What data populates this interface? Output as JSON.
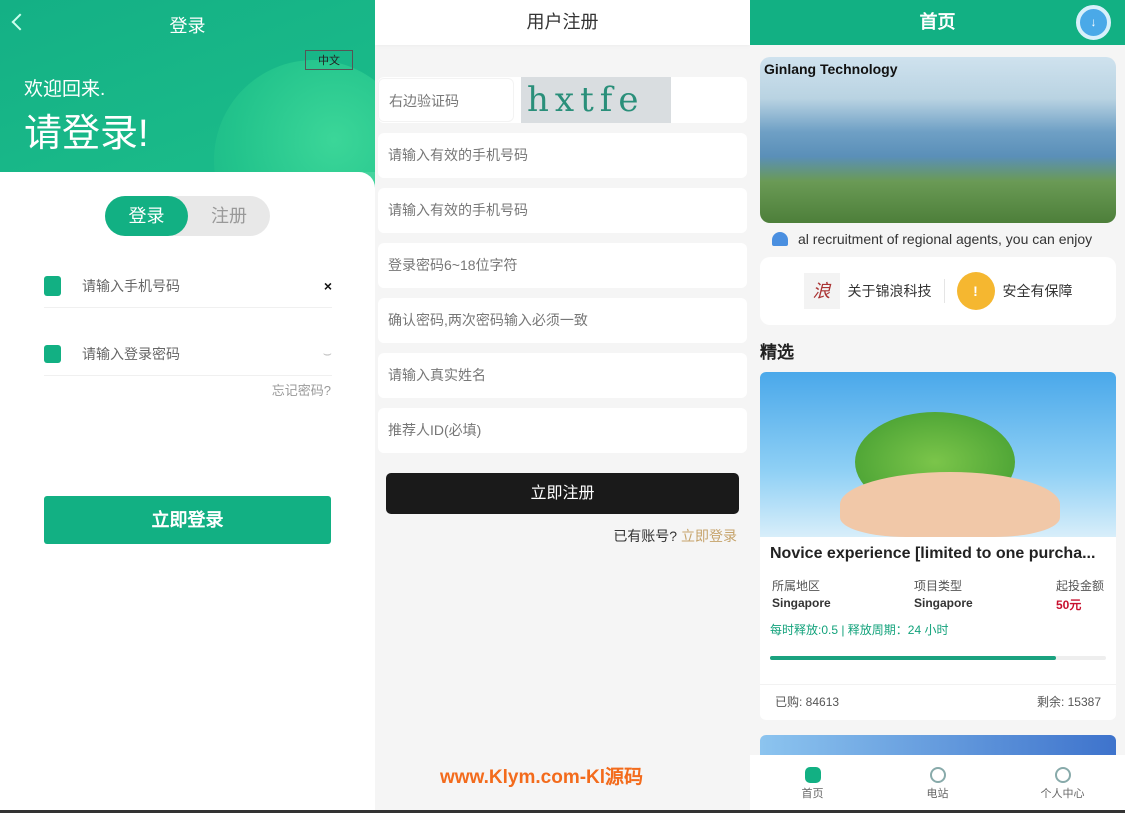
{
  "login": {
    "title": "登录",
    "lang": "中文",
    "welcome": "欢迎回来.",
    "please": "请登录!",
    "tab_login": "登录",
    "tab_register": "注册",
    "phone_placeholder": "请输入手机号码",
    "clear": "×",
    "password_placeholder": "请输入登录密码",
    "forgot": "忘记密码?",
    "submit": "立即登录"
  },
  "register": {
    "title": "用户注册",
    "captcha_placeholder": "右边验证码",
    "captcha_text": "hxtfe",
    "fields": [
      "请输入有效的手机号码",
      "请输入有效的手机号码",
      "登录密码6~18位字符",
      "确认密码,两次密码输入必须一致",
      "请输入真实姓名",
      "推荐人ID(必填)"
    ],
    "submit": "立即注册",
    "have_account": "已有账号?",
    "login_link": "立即登录"
  },
  "home": {
    "title": "首页",
    "download_icon": "↓",
    "banner_text": "Ginlang Technology",
    "notice": "al recruitment of regional agents, you can enjoy",
    "quick": [
      {
        "label": "关于锦浪科技",
        "icon": "浪"
      },
      {
        "label": "安全有保障",
        "icon": "!"
      }
    ],
    "section": "精选",
    "product": {
      "title": "Novice experience [limited to one purcha...",
      "stats": [
        {
          "k": "所属地区",
          "v": "Singapore"
        },
        {
          "k": "项目类型",
          "v": "Singapore"
        },
        {
          "k": "起投金额",
          "v": "50元"
        }
      ],
      "release": "每时释放:0.5 | 释放周期：24 小时",
      "progress": 0.85,
      "bought": "已购: 84613",
      "remaining": "剩余: 15387"
    },
    "tabs": [
      "首页",
      "电站",
      "个人中心"
    ]
  },
  "watermark": "www.Klym.com-Kl源码"
}
